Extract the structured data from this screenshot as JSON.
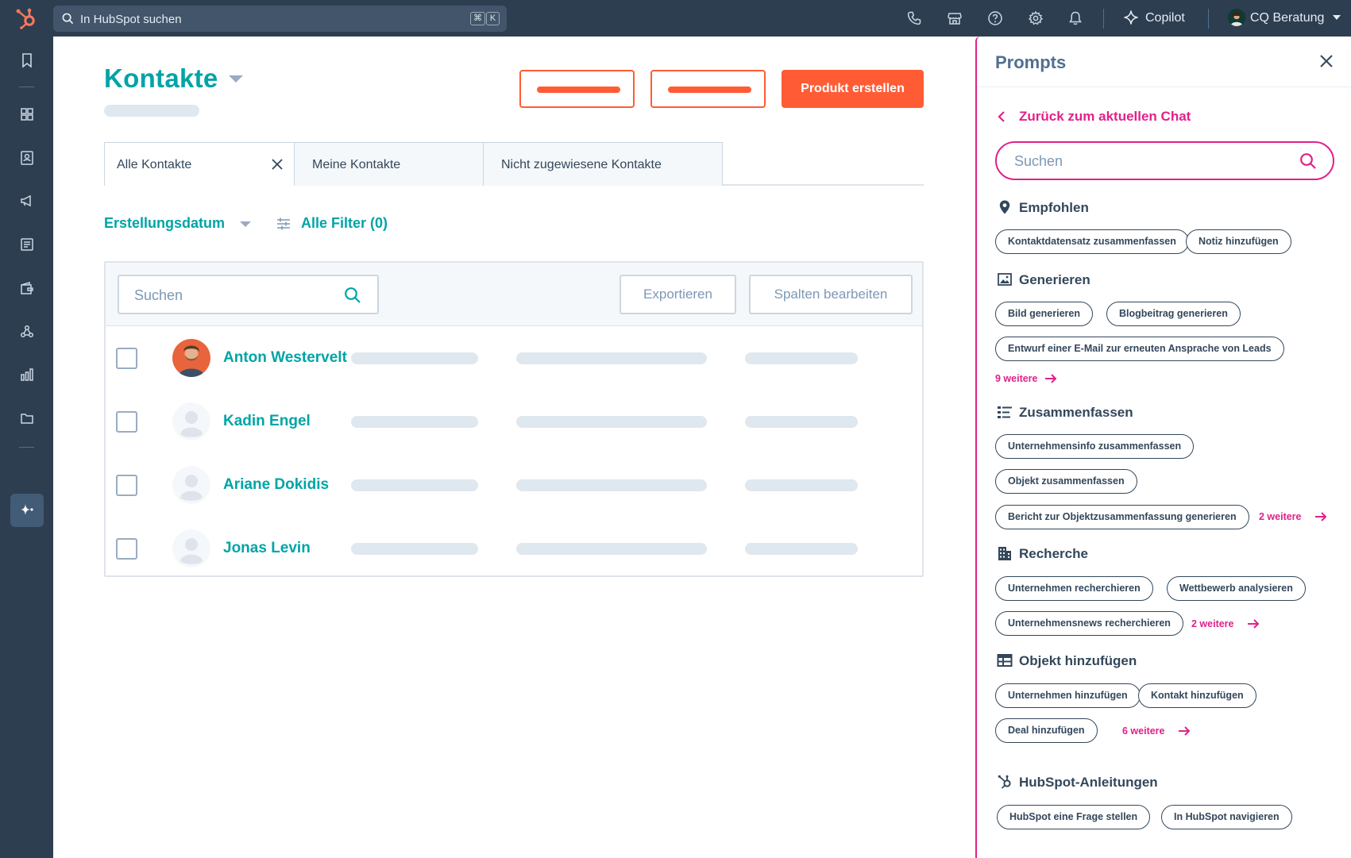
{
  "topbar": {
    "search_placeholder": "In HubSpot suchen",
    "shortcut_cmd": "⌘",
    "shortcut_key": "K",
    "copilot_label": "Copilot",
    "account_name": "CQ Beratung"
  },
  "page": {
    "title": "Kontakte",
    "primary_button": "Produkt erstellen"
  },
  "tabs": [
    {
      "label": "Alle Kontakte"
    },
    {
      "label": "Meine Kontakte"
    },
    {
      "label": "Nicht zugewiesene Kontakte"
    }
  ],
  "filters": {
    "date_filter": "Erstellungsdatum",
    "all_filters": "Alle Filter (0)"
  },
  "table": {
    "search_placeholder": "Suchen",
    "export_label": "Exportieren",
    "edit_columns_label": "Spalten bearbeiten",
    "rows": [
      {
        "name": "Anton Westervelt"
      },
      {
        "name": "Kadin Engel"
      },
      {
        "name": "Ariane Dokidis"
      },
      {
        "name": "Jonas Levin"
      }
    ]
  },
  "panel": {
    "title": "Prompts",
    "back_label": "Zurück zum aktuellen Chat",
    "search_placeholder": "Suchen",
    "sections": {
      "recommended": {
        "title": "Empfohlen",
        "chips": [
          "Kontaktdatensatz zusammenfassen",
          "Notiz hinzufügen"
        ]
      },
      "generate": {
        "title": "Generieren",
        "chips": [
          "Bild generieren",
          "Blogbeitrag generieren",
          "Entwurf einer E-Mail zur erneuten Ansprache von Leads"
        ],
        "more": "9 weitere"
      },
      "summarize": {
        "title": "Zusammenfassen",
        "chips": [
          "Unternehmensinfo zusammenfassen",
          "Objekt zusammenfassen",
          "Bericht zur Objektzusammenfassung generieren"
        ],
        "more": "2 weitere"
      },
      "research": {
        "title": "Recherche",
        "chips": [
          "Unternehmen recherchieren",
          "Wettbewerb analysieren",
          "Unternehmensnews recherchieren"
        ],
        "more": "2 weitere"
      },
      "add_object": {
        "title": "Objekt hinzufügen",
        "chips": [
          "Unternehmen hinzufügen",
          "Kontakt hinzufügen",
          "Deal hinzufügen"
        ],
        "more": "6 weitere"
      },
      "guides": {
        "title": "HubSpot-Anleitungen",
        "chips": [
          "HubSpot eine Frage stellen",
          "In HubSpot navigieren"
        ]
      }
    }
  },
  "colors": {
    "topbar": "#2d3e50",
    "teal": "#00a4a6",
    "orange": "#ff5c35",
    "magenta": "#e0218a"
  }
}
